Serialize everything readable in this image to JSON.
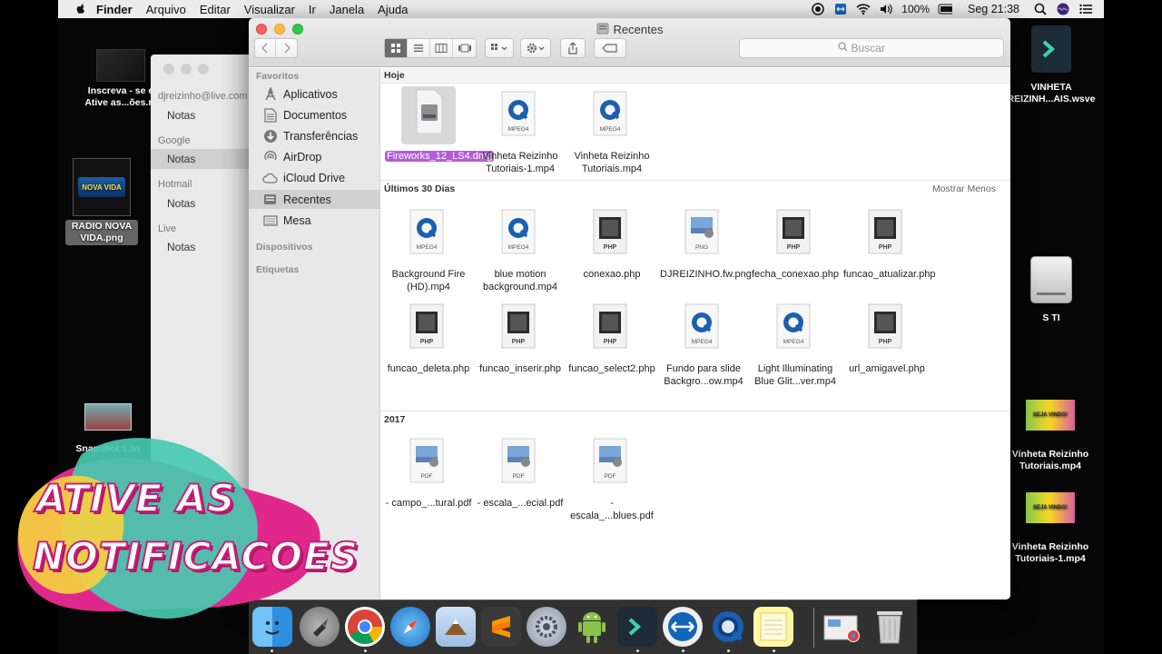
{
  "menubar": {
    "menus": [
      "Finder",
      "Arquivo",
      "Editar",
      "Visualizar",
      "Ir",
      "Janela",
      "Ajuda"
    ],
    "battery": "100%",
    "clock": "Seg 21:38"
  },
  "desktop_left": {
    "notice_line1": "Inscreva - se e",
    "notice_line2": "Ative as...ões.m",
    "radio_label": "RADIO NOVA VIDA.png",
    "radio_logo": "NOVA VIDA",
    "snapshot_label": "Snapshot 1.fw"
  },
  "desktop_right": {
    "vinheta_wsve": "VINHETA REIZINH...AIS.wsve",
    "drive": "S TI",
    "video1": "Vinheta Reizinho Tutoriais.mp4",
    "video2": "Vinheta Reizinho Tutoriais-1.mp4",
    "thumb_text": "SEJA VINDO!"
  },
  "notes_window": {
    "accounts": [
      {
        "name": "djreizinho@live.com",
        "folder": "Notas"
      },
      {
        "name": "Google",
        "folder": "Notas"
      },
      {
        "name": "Hotmail",
        "folder": "Notas"
      },
      {
        "name": "Live",
        "folder": "Notas"
      }
    ]
  },
  "finder": {
    "title": "Recentes",
    "search_placeholder": "Buscar",
    "sidebar": {
      "favorites_head": "Favoritos",
      "items": [
        "Aplicativos",
        "Documentos",
        "Transferências",
        "AirDrop",
        "iCloud Drive",
        "Recentes",
        "Mesa"
      ],
      "devices_head": "Dispositivos",
      "tags_head": "Etiquetas"
    },
    "sections": {
      "today": "Hoje",
      "last30": "Últimos 30 Dias",
      "show_less": "Mostrar Menos",
      "year": "2017"
    },
    "today_files": [
      {
        "name": "Fireworks_12_LS4.dmg",
        "type": "dmg"
      },
      {
        "name": "Vinheta Reizinho Tutoriais-1.mp4",
        "type": "MPEG4"
      },
      {
        "name": "Vinheta Reizinho Tutoriais.mp4",
        "type": "MPEG4"
      }
    ],
    "last30_files": [
      {
        "name": "Background Fire (HD).mp4",
        "type": "MPEG4"
      },
      {
        "name": "blue motion background.mp4",
        "type": "MPEG4"
      },
      {
        "name": "conexao.php",
        "type": "PHP"
      },
      {
        "name": "DJREIZINHO.fw.png",
        "type": "PNG"
      },
      {
        "name": "fecha_conexao.php",
        "type": "PHP"
      },
      {
        "name": "funcao_atualizar.php",
        "type": "PHP"
      },
      {
        "name": "funcao_deleta.php",
        "type": "PHP"
      },
      {
        "name": "funcao_inserir.php",
        "type": "PHP"
      },
      {
        "name": "funcao_select2.php",
        "type": "PHP"
      },
      {
        "name": "Fundo para slide Backgro...ow.mp4",
        "type": "MPEG4"
      },
      {
        "name": "Light Illuminating Blue Glit...ver.mp4",
        "type": "MPEG4"
      },
      {
        "name": "url_amigavel.php",
        "type": "PHP"
      }
    ],
    "year_files": [
      {
        "name": "- campo_...tural.pdf",
        "type": "PDF"
      },
      {
        "name": "- escala_...ecial.pdf",
        "type": "PDF"
      },
      {
        "name": "- escala_...blues.pdf",
        "type": "PDF"
      }
    ]
  },
  "promo": {
    "line1": "ATIVE AS",
    "line2": "NOTIFICACOES"
  },
  "colors": {
    "selection": "#b35bd8",
    "promo_pink": "#e0288c",
    "promo_teal": "#48c9b0",
    "promo_yellow": "#f4d03f"
  }
}
